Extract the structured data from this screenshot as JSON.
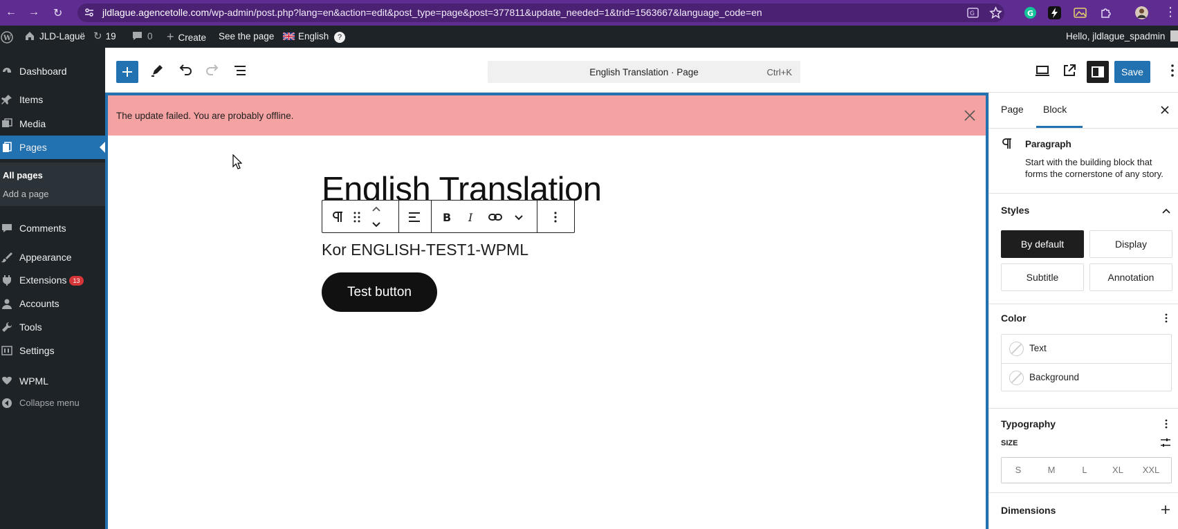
{
  "browser": {
    "url_domain": "jldlague.agencetolle.com",
    "url_path": "/wp-admin/post.php?lang=en&action=edit&post_type=page&post=377811&update_needed=1&trid=1563667&language_code=en"
  },
  "adminbar": {
    "site_name": "JLD-Laguë",
    "updates_count": "19",
    "comments_count": "0",
    "create_label": "Create",
    "see_page_label": "See the page",
    "language_label": "English",
    "greeting": "Hello, jldlague_spadmin"
  },
  "sidebar": {
    "items": [
      {
        "label": "Dashboard",
        "icon": "dashboard-icon"
      },
      {
        "label": "Items",
        "icon": "pin-icon"
      },
      {
        "label": "Media",
        "icon": "media-icon"
      },
      {
        "label": "Pages",
        "icon": "page-icon"
      },
      {
        "label": "Comments",
        "icon": "comment-icon"
      },
      {
        "label": "Appearance",
        "icon": "brush-icon"
      },
      {
        "label": "Extensions",
        "icon": "plugin-icon"
      },
      {
        "label": "Accounts",
        "icon": "user-icon"
      },
      {
        "label": "Tools",
        "icon": "wrench-icon"
      },
      {
        "label": "Settings",
        "icon": "settings-icon"
      },
      {
        "label": "WPML",
        "icon": "wpml-icon"
      },
      {
        "label": "Collapse menu",
        "icon": "collapse-icon"
      }
    ],
    "extensions_badge": "13",
    "submenu": {
      "all_pages": "All pages",
      "add_page": "Add a page"
    }
  },
  "editor_header": {
    "doc_title": "English Translation · Page",
    "shortcut": "Ctrl+K",
    "save_label": "Save"
  },
  "notice": {
    "text": "The update failed. You are probably offline."
  },
  "content": {
    "page_title": "English Translation",
    "paragraph": "Kor ENGLISH-TEST1-WPML",
    "button_label": "Test button"
  },
  "settings": {
    "tabs": [
      "Page",
      "Block"
    ],
    "active_tab": "Block",
    "block_name": "Paragraph",
    "block_description": "Start with the building block that forms the cornerstone of any story.",
    "styles_title": "Styles",
    "styles": [
      "By default",
      "Display",
      "Subtitle",
      "Annotation"
    ],
    "active_style": "By default",
    "color_title": "Color",
    "colors": [
      "Text",
      "Background"
    ],
    "typography_title": "Typography",
    "size_label": "SIZE",
    "sizes": [
      "S",
      "M",
      "L",
      "XL",
      "XXL"
    ],
    "dimensions_title": "Dimensions"
  },
  "colors": {
    "browser_bar": "#5f2d91",
    "admin_dark": "#1d2327",
    "accent": "#2271b1",
    "notice_bg": "#f4a2a2"
  }
}
